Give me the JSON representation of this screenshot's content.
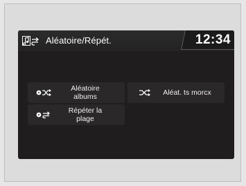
{
  "header": {
    "title": "Aléatoire/Répét.",
    "clock": "12:34",
    "source_icon": "music-note-repeat-icon"
  },
  "menu": {
    "shuffle_albums": {
      "label": "Aléatoire albums",
      "icon": "shuffle-albums-icon"
    },
    "repeat_track": {
      "label": "Répéter la plage",
      "icon": "repeat-track-icon"
    },
    "shuffle_all": {
      "label": "Aléat. ts morcx",
      "icon": "shuffle-all-icon"
    }
  },
  "colors": {
    "screen_bg": "#1f1d1d",
    "button_bg": "#2a2828",
    "text": "#ffffff",
    "page_bg": "#e6e6e6"
  }
}
